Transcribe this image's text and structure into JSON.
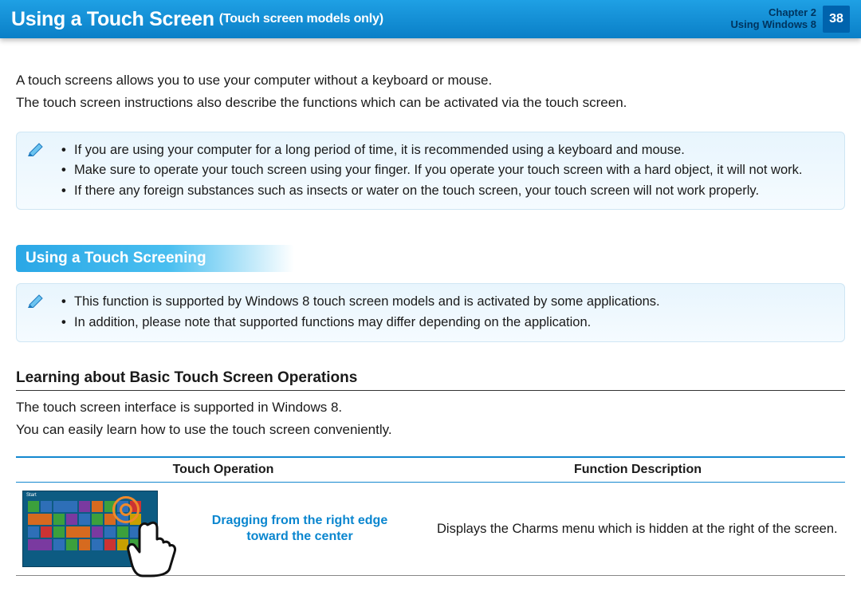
{
  "header": {
    "title": "Using a Touch Screen",
    "subtitle": "(Touch screen models only)",
    "chapter_line1": "Chapter 2",
    "chapter_line2": "Using Windows 8",
    "page_number": "38"
  },
  "intro": {
    "p1": "A touch screens allows you to use your computer without a keyboard or mouse.",
    "p2": "The touch screen instructions also describe the functions which can be activated via the touch screen."
  },
  "note1": {
    "items": [
      "If you are using your computer for a long period of time, it is recommended using a keyboard and mouse.",
      "Make sure to operate your touch screen using your finger. If you operate your touch screen with a hard object, it will not work.",
      "If there any foreign substances such as insects or water on the touch screen, your touch screen will not work properly."
    ]
  },
  "section1": {
    "title": "Using a Touch Screening"
  },
  "note2": {
    "items": [
      "This function is supported by Windows 8 touch screen models and is activated by some applications.",
      "In addition, please note that supported functions may differ depending on the application."
    ]
  },
  "subsection": {
    "title": "Learning about Basic Touch Screen Operations",
    "p1": "The touch screen interface is supported in Windows 8.",
    "p2": "You can easily learn how to use the touch screen conveniently."
  },
  "table": {
    "headers": {
      "op": "Touch Operation",
      "desc": "Function Description"
    },
    "rows": [
      {
        "op_label_line1": "Dragging from the right edge",
        "op_label_line2": "toward the center",
        "desc": "Displays the Charms menu which is hidden at the right of the screen."
      }
    ]
  }
}
